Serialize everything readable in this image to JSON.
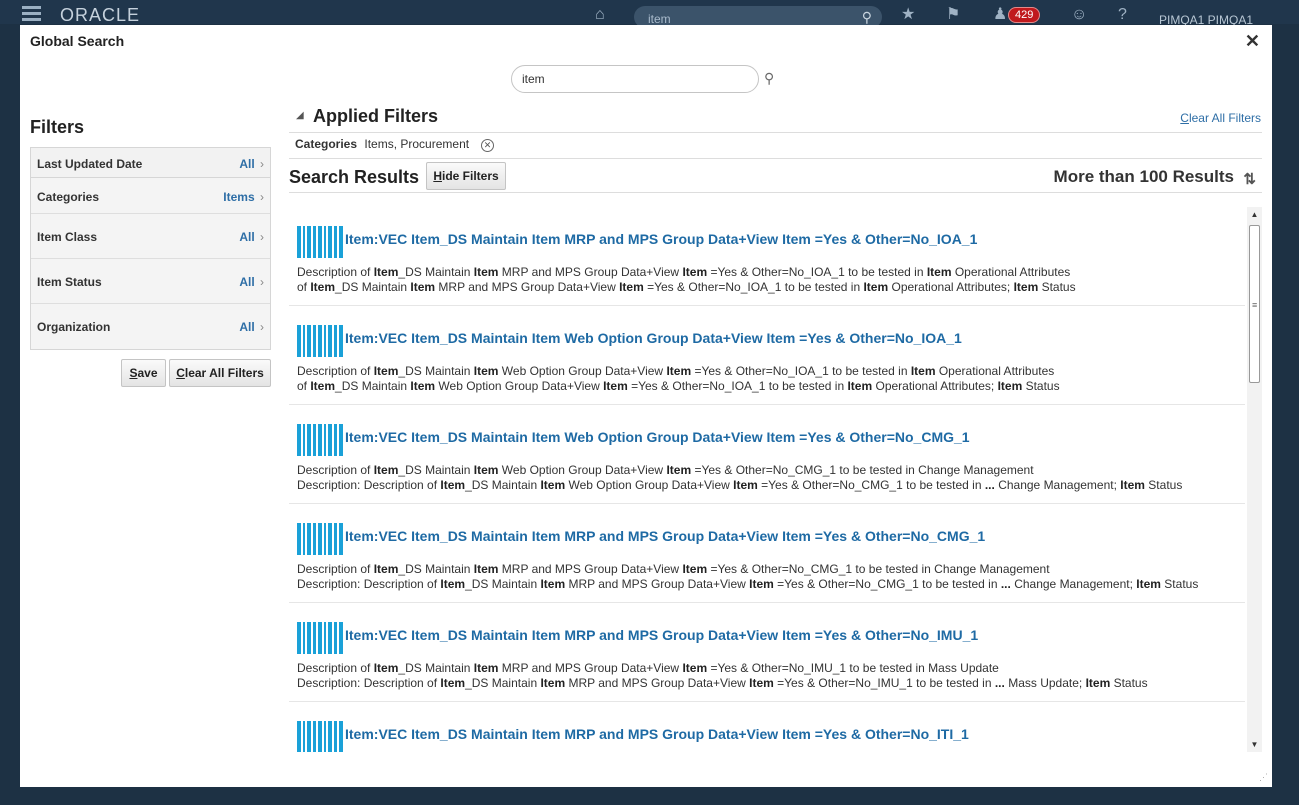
{
  "topbar": {
    "logo": "ORACLE",
    "search_value": "item",
    "notifications_count": "429",
    "user_name": "PIMQA1 PIMQA1"
  },
  "dialog": {
    "title": "Global Search",
    "close_glyph": "✕",
    "search_value": "item"
  },
  "filters": {
    "title": "Filters",
    "items": [
      {
        "label": "Last Updated Date",
        "value": "All"
      },
      {
        "label": "Categories",
        "value": "Items"
      },
      {
        "label": "Item Class",
        "value": "All"
      },
      {
        "label": "Item Status",
        "value": "All"
      },
      {
        "label": "Organization",
        "value": "All"
      }
    ],
    "save_first": "S",
    "save_rest": "ave",
    "clear_first": "C",
    "clear_rest": "lear All Filters"
  },
  "applied": {
    "title": "Applied Filters",
    "clear_first": "C",
    "clear_rest": "lear All Filters",
    "category_label": "Categories",
    "category_value": "Items, Procurement"
  },
  "results_header": {
    "title": "Search Results",
    "hide_first": "H",
    "hide_rest": "ide Filters",
    "count": "More than 100 Results"
  },
  "results": [
    {
      "title": "Item:VEC Item_DS Maintain Item MRP and MPS Group Data+View Item =Yes & Other=No_IOA_1",
      "line1": [
        [
          "Description of ",
          0
        ],
        [
          "Item",
          1
        ],
        [
          "_DS Maintain ",
          0
        ],
        [
          "Item",
          1
        ],
        [
          " MRP and MPS Group Data+View ",
          0
        ],
        [
          "Item",
          1
        ],
        [
          " =Yes & Other=No_IOA_1 to be tested in ",
          0
        ],
        [
          "Item",
          1
        ],
        [
          " Operational Attributes",
          0
        ]
      ],
      "line2": [
        [
          "of ",
          0
        ],
        [
          "Item",
          1
        ],
        [
          "_DS Maintain ",
          0
        ],
        [
          "Item",
          1
        ],
        [
          " MRP and MPS Group Data+View ",
          0
        ],
        [
          "Item",
          1
        ],
        [
          " =Yes & Other=No_IOA_1 to be tested in ",
          0
        ],
        [
          "Item",
          1
        ],
        [
          " Operational Attributes; ",
          0
        ],
        [
          "Item",
          1
        ],
        [
          " Status",
          0
        ]
      ]
    },
    {
      "title": "Item:VEC Item_DS Maintain Item Web Option Group Data+View Item =Yes & Other=No_IOA_1",
      "line1": [
        [
          "Description of ",
          0
        ],
        [
          "Item",
          1
        ],
        [
          "_DS Maintain ",
          0
        ],
        [
          "Item",
          1
        ],
        [
          " Web Option Group Data+View ",
          0
        ],
        [
          "Item",
          1
        ],
        [
          " =Yes & Other=No_IOA_1 to be tested in ",
          0
        ],
        [
          "Item",
          1
        ],
        [
          " Operational Attributes",
          0
        ]
      ],
      "line2": [
        [
          "of ",
          0
        ],
        [
          "Item",
          1
        ],
        [
          "_DS Maintain ",
          0
        ],
        [
          "Item",
          1
        ],
        [
          " Web Option Group Data+View ",
          0
        ],
        [
          "Item",
          1
        ],
        [
          " =Yes & Other=No_IOA_1 to be tested in ",
          0
        ],
        [
          "Item",
          1
        ],
        [
          " Operational Attributes; ",
          0
        ],
        [
          "Item",
          1
        ],
        [
          " Status",
          0
        ]
      ]
    },
    {
      "title": "Item:VEC Item_DS Maintain Item Web Option Group Data+View Item =Yes & Other=No_CMG_1",
      "line1": [
        [
          "Description of ",
          0
        ],
        [
          "Item",
          1
        ],
        [
          "_DS Maintain ",
          0
        ],
        [
          "Item",
          1
        ],
        [
          " Web Option Group Data+View ",
          0
        ],
        [
          "Item",
          1
        ],
        [
          " =Yes & Other=No_CMG_1 to be tested in Change Management",
          0
        ]
      ],
      "line2": [
        [
          "Description: Description of ",
          0
        ],
        [
          "Item",
          1
        ],
        [
          "_DS Maintain ",
          0
        ],
        [
          "Item",
          1
        ],
        [
          " Web Option Group Data+View ",
          0
        ],
        [
          "Item",
          1
        ],
        [
          " =Yes & Other=No_CMG_1 to be tested in ",
          0
        ],
        [
          "...",
          1
        ],
        [
          " Change Management; ",
          0
        ],
        [
          "Item",
          1
        ],
        [
          " Status",
          0
        ]
      ]
    },
    {
      "title": "Item:VEC Item_DS Maintain Item MRP and MPS Group Data+View Item =Yes & Other=No_CMG_1",
      "line1": [
        [
          "Description of ",
          0
        ],
        [
          "Item",
          1
        ],
        [
          "_DS Maintain ",
          0
        ],
        [
          "Item",
          1
        ],
        [
          " MRP and MPS Group Data+View ",
          0
        ],
        [
          "Item",
          1
        ],
        [
          " =Yes & Other=No_CMG_1 to be tested in Change Management",
          0
        ]
      ],
      "line2": [
        [
          "Description: Description of ",
          0
        ],
        [
          "Item",
          1
        ],
        [
          "_DS Maintain ",
          0
        ],
        [
          "Item",
          1
        ],
        [
          " MRP and MPS Group Data+View ",
          0
        ],
        [
          "Item",
          1
        ],
        [
          " =Yes & Other=No_CMG_1 to be tested in ",
          0
        ],
        [
          "...",
          1
        ],
        [
          " Change Management; ",
          0
        ],
        [
          "Item",
          1
        ],
        [
          " Status",
          0
        ]
      ]
    },
    {
      "title": "Item:VEC Item_DS Maintain Item MRP and MPS Group Data+View Item =Yes & Other=No_IMU_1",
      "line1": [
        [
          "Description of ",
          0
        ],
        [
          "Item",
          1
        ],
        [
          "_DS Maintain ",
          0
        ],
        [
          "Item",
          1
        ],
        [
          " MRP and MPS Group Data+View ",
          0
        ],
        [
          "Item",
          1
        ],
        [
          " =Yes & Other=No_IMU_1 to be tested in Mass Update",
          0
        ]
      ],
      "line2": [
        [
          "Description: Description of ",
          0
        ],
        [
          "Item",
          1
        ],
        [
          "_DS Maintain ",
          0
        ],
        [
          "Item",
          1
        ],
        [
          " MRP and MPS Group Data+View ",
          0
        ],
        [
          "Item",
          1
        ],
        [
          " =Yes & Other=No_IMU_1 to be tested in ",
          0
        ],
        [
          "...",
          1
        ],
        [
          " Mass Update; ",
          0
        ],
        [
          "Item",
          1
        ],
        [
          " Status",
          0
        ]
      ]
    },
    {
      "title": "Item:VEC Item_DS Maintain Item MRP and MPS Group Data+View Item =Yes & Other=No_ITI_1",
      "line1": [],
      "line2": []
    }
  ],
  "icons": {
    "home": "home-icon",
    "search": "search-icon",
    "favorites": "star-icon",
    "watchlist": "flag-icon",
    "notifications": "bell-icon",
    "accessibility": "accessibility-icon",
    "help": "help-icon",
    "result": "barcode-icon",
    "sort": "sort-icon"
  },
  "colors": {
    "link": "#1e6aa4",
    "barcode": "#1aa1d8",
    "badge": "#c0191d",
    "topbar": "#20364c"
  }
}
